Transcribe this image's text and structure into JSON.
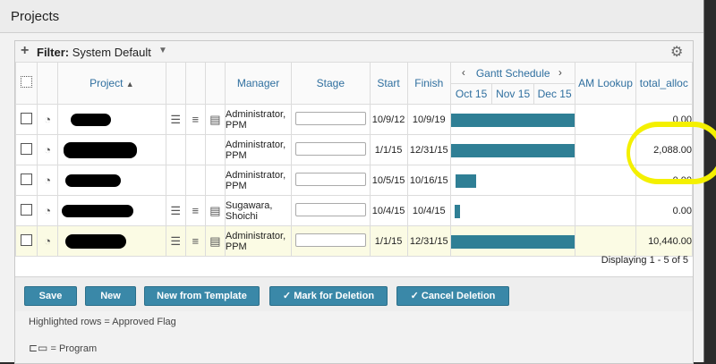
{
  "window": {
    "title": "Projects"
  },
  "filter": {
    "label": "Filter:",
    "value": "System Default"
  },
  "columns": {
    "project": "Project",
    "manager": "Manager",
    "stage": "Stage",
    "start": "Start",
    "finish": "Finish",
    "gantt": "Gantt Schedule",
    "months": [
      "Oct 15",
      "Nov 15",
      "Dec 15"
    ],
    "am_lookup": "AM Lookup",
    "total_alloc": "total_alloc"
  },
  "rows": [
    {
      "manager_l1": "Administrator,",
      "manager_l2": "PPM",
      "start": "10/9/12",
      "finish": "10/9/19",
      "total": "0.00",
      "highlighted": false
    },
    {
      "manager_l1": "Administrator,",
      "manager_l2": "PPM",
      "start": "1/1/15",
      "finish": "12/31/15",
      "total": "2,088.00",
      "highlighted": false
    },
    {
      "manager_l1": "Administrator,",
      "manager_l2": "PPM",
      "start": "10/5/15",
      "finish": "10/16/15",
      "total": "0.00",
      "highlighted": false
    },
    {
      "manager_l1": "Sugawara,",
      "manager_l2": "Shoichi",
      "start": "10/4/15",
      "finish": "10/4/15",
      "total": "0.00",
      "highlighted": false
    },
    {
      "manager_l1": "Administrator,",
      "manager_l2": "PPM",
      "start": "1/1/15",
      "finish": "12/31/15",
      "total": "10,440.00",
      "highlighted": true
    }
  ],
  "display_text": "Displaying 1 - 5 of 5",
  "buttons": {
    "save": "Save",
    "new": "New",
    "new_from_template": "New from Template",
    "mark_for_deletion": "Mark for Deletion",
    "cancel_deletion": "Cancel Deletion"
  },
  "notes": {
    "highlighted": "Highlighted rows = Approved Flag",
    "program": "= Program"
  },
  "colors": {
    "bar": "#2f7f95",
    "button": "#3a88a8",
    "highlight_row": "#fbfbe4",
    "annotation": "#f4f000"
  }
}
